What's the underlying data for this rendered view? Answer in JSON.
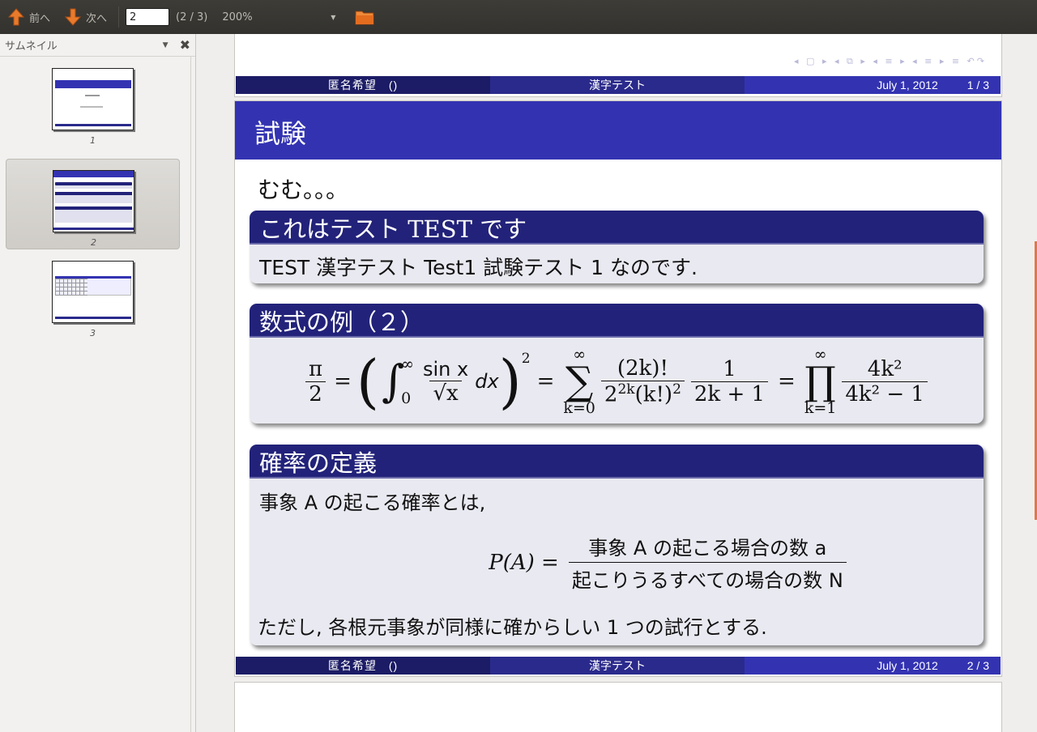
{
  "toolbar": {
    "prev_label": "前へ",
    "next_label": "次へ",
    "page_value": "2",
    "page_count": "(2 / 3)",
    "zoom_value": "200%"
  },
  "sidebar": {
    "title": "サムネイル",
    "thumbnails": [
      {
        "label": "1"
      },
      {
        "label": "2"
      },
      {
        "label": "3"
      }
    ]
  },
  "slide_footer": {
    "author": "匿名希望　()",
    "title": "漢字テスト",
    "date": "July 1, 2012",
    "page1": "1 / 3",
    "page2": "2 / 3"
  },
  "slide": {
    "frame_title": "試験",
    "lead": "むむ。。。",
    "block1": {
      "title": "これはテスト TEST です",
      "body": "TEST 漢字テスト Test1 試験テスト 1 なのです."
    },
    "block2": {
      "title": "数式の例（２）",
      "pi": "π",
      "two": "2",
      "sin": "sin x",
      "sqrt": "√x",
      "dx": "dx",
      "inf": "∞",
      "zero": "0",
      "sum_lower": "k=0",
      "num1": "(2k)!",
      "den1": "2^{2k}(k!)^2",
      "num2": "1",
      "den2": "2k + 1",
      "prod_lower": "k=1",
      "num3": "4k²",
      "den3": "4k² − 1"
    },
    "block3": {
      "title": "確率の定義",
      "line1": "事象 A の起こる確率とは,",
      "lhs": "P(A) =",
      "numerator": "事象 A の起こる場合の数 a",
      "denominator": "起こりうるすべての場合の数 N",
      "line2": "ただし, 各根元事象が同様に確からしい 1 つの試行とする."
    }
  }
}
